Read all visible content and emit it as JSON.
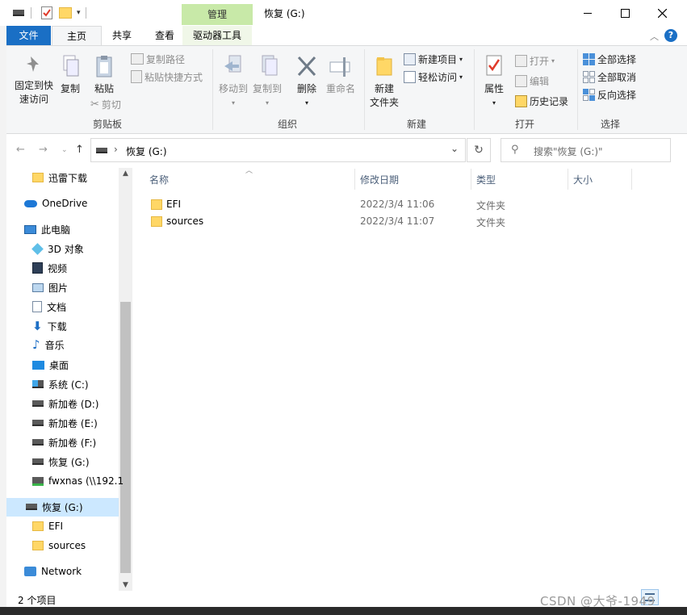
{
  "title_bar": {
    "context_tab": "管理",
    "window_title": "恢复 (G:)"
  },
  "ribbon_tabs": [
    "文件",
    "主页",
    "共享",
    "查看",
    "驱动器工具"
  ],
  "ribbon": {
    "clipboard": {
      "pin": "固定到快速访问",
      "pin_l1": "固定到快",
      "pin_l2": "速访问",
      "copy": "复制",
      "paste": "粘贴",
      "copy_path": "复制路径",
      "paste_shortcut": "粘贴快捷方式",
      "cut": "剪切",
      "label": "剪贴板"
    },
    "organize": {
      "move_to": "移动到",
      "copy_to": "复制到",
      "delete": "删除",
      "rename": "重命名",
      "label": "组织"
    },
    "new": {
      "new_folder_l1": "新建",
      "new_folder_l2": "文件夹",
      "new_item": "新建项目",
      "easy_access": "轻松访问",
      "label": "新建"
    },
    "open": {
      "properties": "属性",
      "open": "打开",
      "edit": "编辑",
      "history": "历史记录",
      "label": "打开"
    },
    "select": {
      "select_all": "全部选择",
      "select_none": "全部取消",
      "invert": "反向选择",
      "label": "选择"
    }
  },
  "address": {
    "path": "恢复 (G:)",
    "search_placeholder": "搜索\"恢复 (G:)\""
  },
  "nav_pane": {
    "items": [
      {
        "label": "迅雷下载",
        "icon": "folder-icon"
      },
      {
        "label": "OneDrive",
        "icon": "cloud-icon"
      },
      {
        "label": "此电脑",
        "icon": "computer-icon"
      },
      {
        "label": "3D 对象",
        "icon": "cube-icon"
      },
      {
        "label": "视频",
        "icon": "video-icon"
      },
      {
        "label": "图片",
        "icon": "picture-icon"
      },
      {
        "label": "文档",
        "icon": "document-icon"
      },
      {
        "label": "下载",
        "icon": "download-arrow-icon"
      },
      {
        "label": "音乐",
        "icon": "music-note-icon"
      },
      {
        "label": "桌面",
        "icon": "desktop-icon"
      },
      {
        "label": "系统 (C:)",
        "icon": "system-drive-icon"
      },
      {
        "label": "新加卷 (D:)",
        "icon": "drive-icon"
      },
      {
        "label": "新加卷 (E:)",
        "icon": "drive-icon"
      },
      {
        "label": "新加卷 (F:)",
        "icon": "drive-icon"
      },
      {
        "label": "恢复 (G:)",
        "icon": "drive-icon"
      },
      {
        "label": "fwxnas (\\\\192.1",
        "icon": "network-drive-icon"
      },
      {
        "label": "恢复 (G:)",
        "icon": "drive-icon"
      },
      {
        "label": "EFI",
        "icon": "folder-icon"
      },
      {
        "label": "sources",
        "icon": "folder-icon"
      },
      {
        "label": "Network",
        "icon": "network-icon"
      }
    ]
  },
  "file_list": {
    "columns": [
      "名称",
      "修改日期",
      "类型",
      "大小"
    ],
    "rows": [
      {
        "name": "EFI",
        "modified": "2022/3/4 11:06",
        "type": "文件夹",
        "size": ""
      },
      {
        "name": "sources",
        "modified": "2022/3/4 11:07",
        "type": "文件夹",
        "size": ""
      }
    ]
  },
  "status_bar": {
    "item_count": "2 个项目"
  },
  "watermark": "CSDN @大爷-1949",
  "colors": {
    "file_tab": "#1a6fc5",
    "context_tab": "#c8e9a8",
    "ribbon_bg": "#f5f6f7",
    "selected_nav": "#cce8ff"
  }
}
